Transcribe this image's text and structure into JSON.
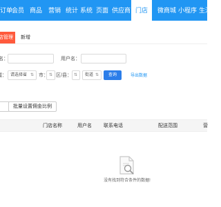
{
  "topnav": {
    "items": [
      {
        "label": "订单"
      },
      {
        "label": "会员"
      },
      {
        "label": "商品"
      },
      {
        "label": "营销"
      },
      {
        "label": "统计"
      },
      {
        "label": "系统"
      },
      {
        "label": "页面"
      },
      {
        "label": "供应商"
      },
      {
        "label": "门店",
        "active": true
      },
      {
        "label": "微商城"
      },
      {
        "label": "小程序"
      },
      {
        "label": "生活号"
      }
    ],
    "bg_color": "#2196f3"
  },
  "tabs": {
    "active_label": "门店管理",
    "new_label": "新增",
    "active_color": "#ff5a3c"
  },
  "filters": {
    "store_name_label": "门店名：",
    "username_label": "用户名：",
    "region_label": "区域：",
    "province_select": "请选择省",
    "city_label": "市：",
    "district_label": "区/县：",
    "street_label": "街道",
    "query_button": "查询",
    "export_link": "导出数据"
  },
  "actions": {
    "first_button": "",
    "batch_commission_button": "批量设置佣金比例"
  },
  "table": {
    "columns": [
      "门店名称",
      "用户名",
      "联系电话",
      "配送范围",
      "营"
    ],
    "empty_text": "没有找到符合条件的数据!"
  }
}
